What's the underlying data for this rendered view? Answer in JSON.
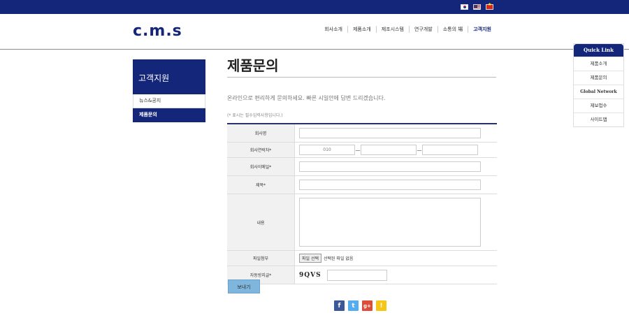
{
  "header": {
    "logo": "c.m.s",
    "flags": [
      "kr-flag-icon",
      "us-flag-icon",
      "vn-flag-icon"
    ],
    "nav": [
      "회사소개",
      "제품소개",
      "제조시스템",
      "연구개발",
      "소통의 場",
      "고객지원"
    ]
  },
  "sidebar": {
    "title": "고객지원",
    "items": [
      "뉴스&공지",
      "제품문의"
    ]
  },
  "main": {
    "title": "제품문의",
    "intro": "온라인으로 편리하게 문의하세요. 빠른 시일안에 답변 드리겠습니다.",
    "required_note": "(* 표시는 필수입력사항입니다.)"
  },
  "form": {
    "company_label": "회사명",
    "phone_label": "회사연락처*",
    "phone_prefix": "010",
    "phone_sep": "—",
    "email_label": "회사이메일*",
    "subject_label": "제목*",
    "content_label": "내용",
    "file_label": "파일첨부",
    "file_button": "파일 선택",
    "file_status": "선택된 파일 없음",
    "captcha_label": "자동방지글*",
    "captcha_code": "9QVS",
    "submit_label": "보내기"
  },
  "social": [
    "facebook-icon",
    "twitter-icon",
    "google-plus-icon",
    "kakaostory-icon"
  ],
  "quick_link": {
    "title": "Quick Link",
    "items": [
      "제품소개",
      "제품문의",
      "Global Network",
      "제보접수",
      "사이트맵"
    ]
  },
  "colors": {
    "brand": "#14267a",
    "submit": "#7fb6de"
  }
}
